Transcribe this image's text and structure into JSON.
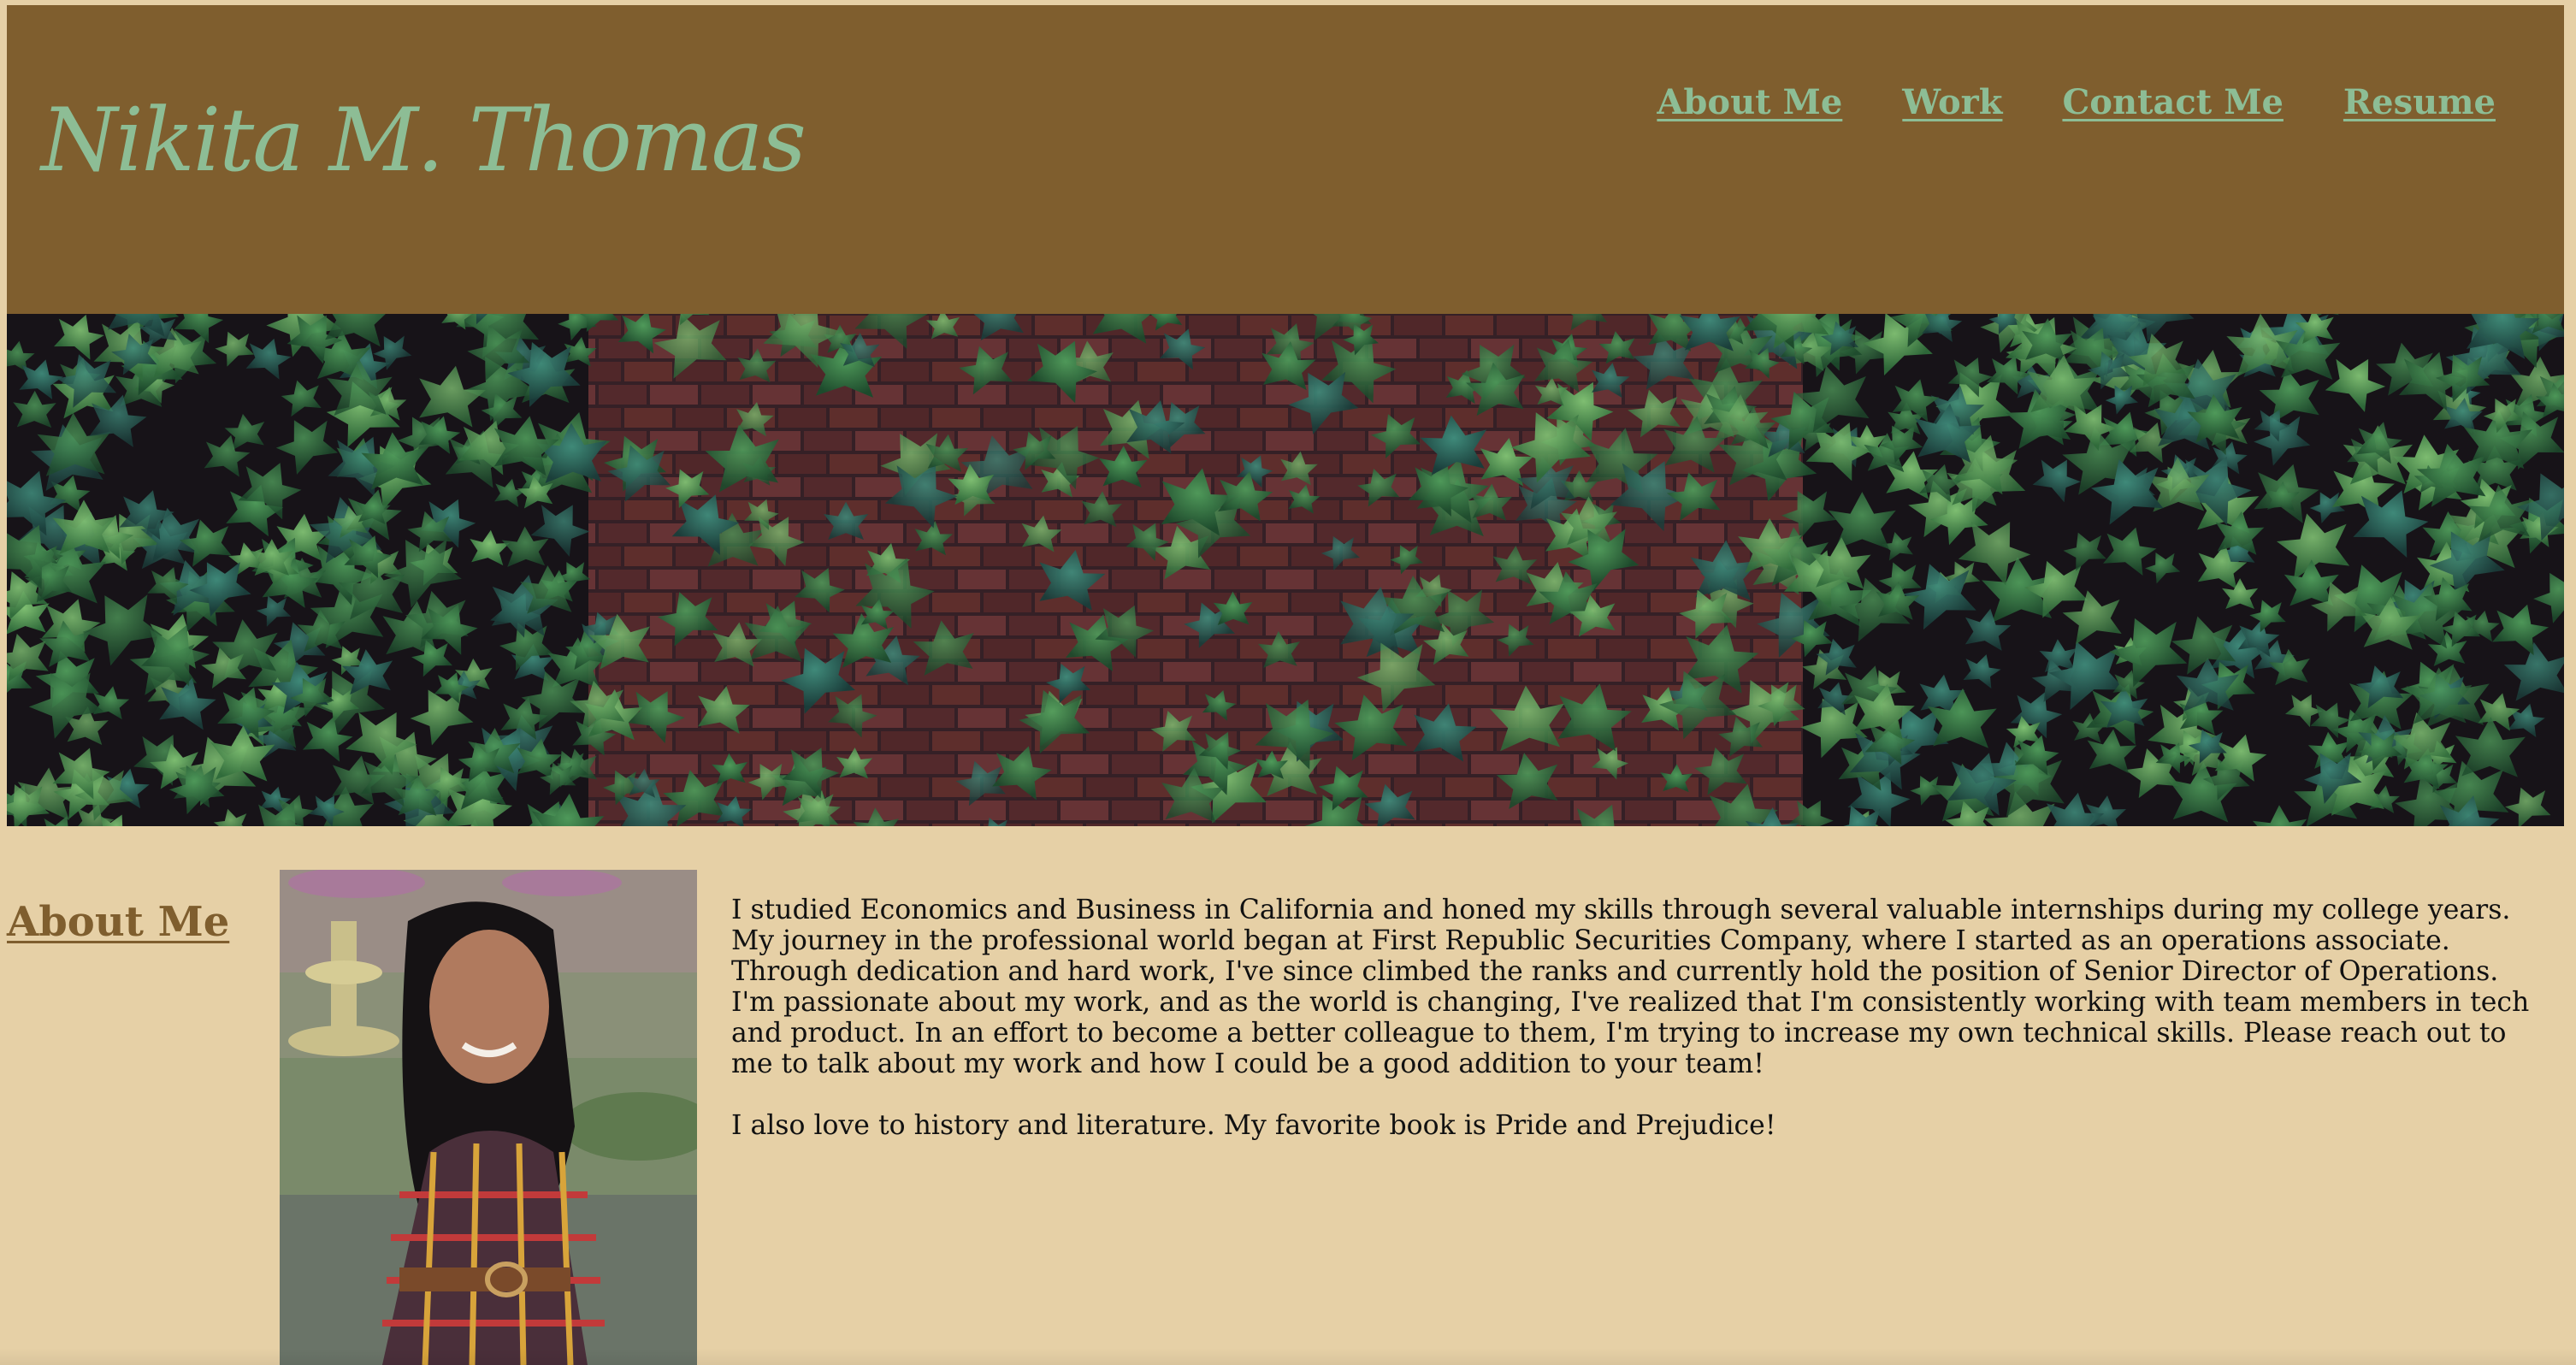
{
  "header": {
    "site_title": "Nikita M. Thomas",
    "nav": [
      {
        "label": "About Me"
      },
      {
        "label": "Work"
      },
      {
        "label": "Contact Me"
      },
      {
        "label": "Resume"
      }
    ]
  },
  "hero": {
    "image": "ivy-on-brick-wall-photo"
  },
  "about": {
    "heading": "About Me",
    "portrait": "portrait-photo",
    "paragraphs": [
      "I studied Economics and Business in California and honed my skills through several valuable internships during my college years. My journey in the professional world began at First Republic Securities Company, where I started as an operations associate. Through dedication and hard work, I've since climbed the ranks and currently hold the position of Senior Director of Operations. I'm passionate about my work, and as the world is changing, I've realized that I'm consistently working with team members in tech and product. In an effort to become a better colleague to them, I'm trying to increase my own technical skills. Please reach out to me to talk about my work and how I could be a good addition to your team!",
      "I also love to history and literature. My favorite book is Pride and Prejudice!"
    ]
  },
  "colors": {
    "page_background": "#e6d0a6",
    "header_background": "#7f5e2e",
    "accent_green": "#8dbd95",
    "heading_brown": "#7f5e2e"
  }
}
